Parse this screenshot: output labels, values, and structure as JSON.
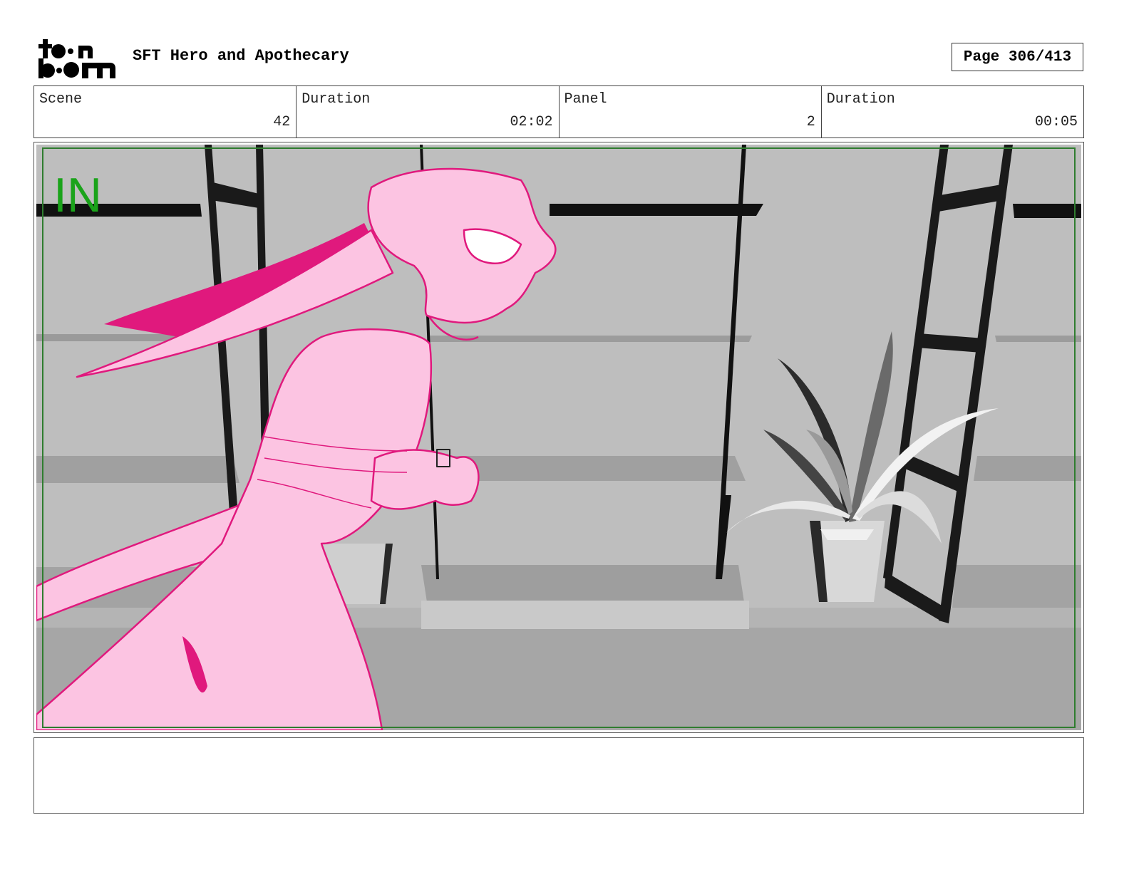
{
  "header": {
    "logo_text": "toon boom",
    "title": "SFT Hero and Apothecary",
    "page": "Page 306/413"
  },
  "info": {
    "scene_label": "Scene",
    "scene_value": "42",
    "scene_duration_label": "Duration",
    "scene_duration_value": "02:02",
    "panel_label": "Panel",
    "panel_value": "2",
    "panel_duration_label": "Duration",
    "panel_duration_value": "00:05"
  },
  "panel": {
    "marker": "IN",
    "marker_color": "#1aa31a",
    "safe_frame_color": "#2f7d2f",
    "character_fill": "#fcc4e2",
    "character_line": "#e0197d"
  },
  "notes": {
    "text": ""
  }
}
